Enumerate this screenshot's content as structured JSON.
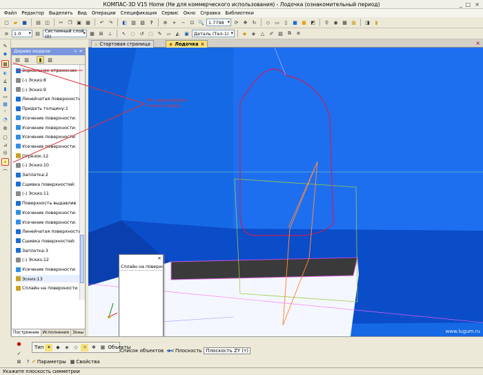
{
  "window": {
    "title": "КОМПАС-3D V15 Home (Не для коммерческого использования) - Лодочка (ознакомительный период)"
  },
  "menu": [
    "Файл",
    "Редактор",
    "Выделить",
    "Вид",
    "Операции",
    "Спецификация",
    "Сервис",
    "Окно",
    "Справка",
    "Библиотеки"
  ],
  "toolbar": {
    "line_width": "1.0",
    "layer": "Системный слой (0)",
    "zoom": "1.7798",
    "detail": "Деталь (Тел-1)"
  },
  "tabs": [
    {
      "label": "Стартовая страница"
    },
    {
      "label": "Лодочка"
    }
  ],
  "tree": {
    "header": "Дерево модели",
    "items": [
      "Зеркальное отражение",
      "(-) Эскиз:8",
      "(-) Эскиз:9",
      "Линейчатая поверхность",
      "Придать толщину:1",
      "Усечение поверхности:",
      "Усечение поверхности:",
      "Усечение поверхности:",
      "Усечение поверхности:",
      "Отрезок:12",
      "(-) Эскиз:10",
      "Заплатка:2",
      "Сшивка поверхностей:",
      "(-) Эскиз:11",
      "Поверхность выдавлив",
      "Усечение поверхности:",
      "Усечение поверхности:",
      "Линейчатая поверхность",
      "Сшивка поверхностей:",
      "Заплатка:3",
      "(-) Эскиз:12",
      "Усечение поверхности:",
      "Эскиз:13",
      "Сплайн на поверхности"
    ],
    "bottom_tabs": [
      "Построение",
      "Исполнения",
      "Зоны"
    ]
  },
  "annotation": {
    "text_line1": "Это надо выбрать",
    "text_line2": "в меню справа"
  },
  "popup": {
    "item": "Сплайн на поверхност"
  },
  "props": {
    "type_label": "Тип",
    "objects_label": "Объекты",
    "object_list_label": "Список объектов",
    "collapse": "<<",
    "plane_label": "Плоскость",
    "plane_value": "Плоскость ZY (т)",
    "params_tab": "Параметры",
    "props_tab": "Свойства"
  },
  "status": {
    "hint": "Укажите плоскость симметрии"
  },
  "watermark": "www.lugum.ru",
  "colors": {
    "viewport_blue": "#1565e0",
    "floor_blue": "#0a48c6",
    "annot_red": "#e0303a",
    "selection_green": "#9ccc41"
  }
}
